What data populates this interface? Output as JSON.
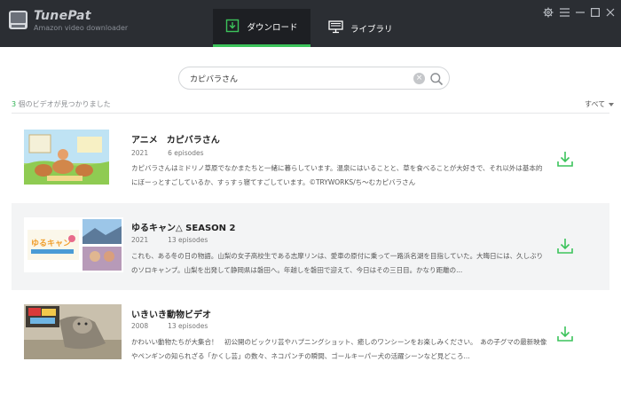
{
  "app": {
    "name": "TunePat",
    "subtitle": "Amazon video downloader"
  },
  "nav": {
    "download_label": "ダウンロード",
    "library_label": "ライブラリ"
  },
  "search": {
    "value": "カピバラさん"
  },
  "results": {
    "count": "3",
    "count_suffix": " 個のビデオが見つかりました",
    "filter_label": "すべて"
  },
  "videos": [
    {
      "title": "アニメ　カピバラさん",
      "year": "2021",
      "episodes": "6 episodes",
      "description": "カピバラさんはミドリノ草原でなかまたちと一緒に暮らしています。温泉にはいることと、草を食べることが大好きで、それ以外は基本的にぼーっとすごしているか、すぅすぅ寝てすごしています。©TRYWORKS/ち～むカピバラさん"
    },
    {
      "title": "ゆるキャン△ SEASON 2",
      "year": "2021",
      "episodes": "13 episodes",
      "description": "これも、ある冬の日の物語。山梨の女子高校生である志摩リンは、愛車の原付に乗って一路浜名湖を目指していた。大晦日には、久しぶりのソロキャンプ。山梨を出発して静岡県は磐田へ。年越しを磐田で迎えて、今日はその三日目。かなり距離の..."
    },
    {
      "title": "いきいき動物ビデオ",
      "year": "2008",
      "episodes": "13 episodes",
      "description": "かわいい動物たちが大集合！　初公開のビックリ芸やハプニングショット、癒しのワンシーンをお楽しみください。　あの子グマの最新映像やペンギンの知られざる「かくし芸」の数々、ネコパンチの瞬間、ゴールキーパー犬の活躍シーンなど見どころ..."
    }
  ],
  "colors": {
    "titlebar": "#2b2e33",
    "accent": "#3cc35b",
    "row_highlight": "#f3f4f5"
  }
}
